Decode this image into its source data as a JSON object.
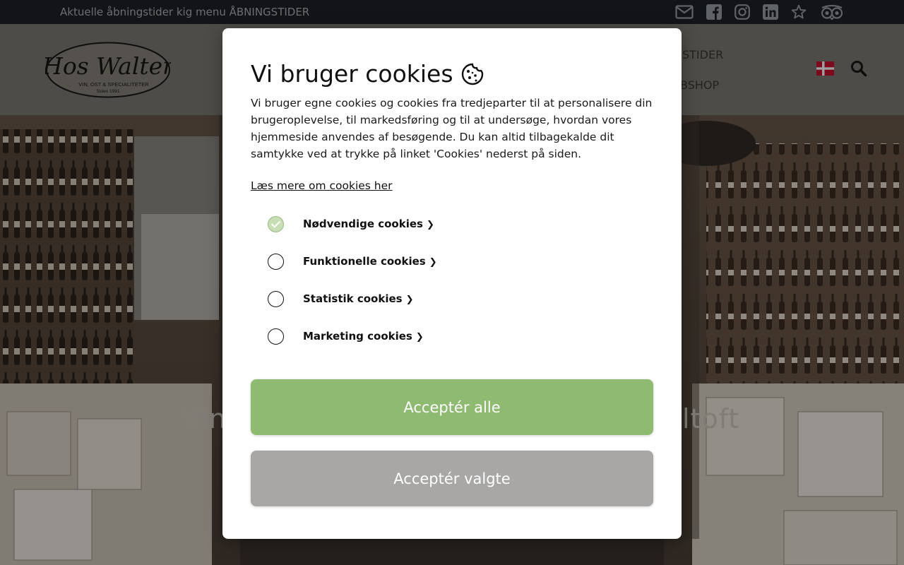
{
  "topbar": {
    "text": "Aktuelle åbningstider kig menu ÅBNINGSTIDER",
    "icons": [
      "envelope-icon",
      "facebook-icon",
      "instagram-icon",
      "linkedin-icon",
      "star-icon",
      "tripadvisor-icon"
    ]
  },
  "header": {
    "logo_title": "Hos Walter",
    "logo_subtitle": "VIN, OST & SPECIALITETER",
    "logo_since": "Siden 1991",
    "nav_partial_1": "STIDER",
    "nav_partial_2": "BSHOP",
    "flag": "denmark-flag",
    "icons": [
      "search-icon"
    ]
  },
  "hero": {
    "title_left": "Vin",
    "title_right": "ltoft"
  },
  "cookie_modal": {
    "title": "Vi bruger cookies",
    "description": "Vi bruger egne cookies og cookies fra tredjeparter til at personalisere din brugeroplevelse, til markedsføring og til at undersøge, hvordan vores hjemmeside anvendes af besøgende. Du kan altid tilbagekalde dit samtykke ved at trykke på linket 'Cookies' nederst på siden.",
    "read_more": "Læs mere om cookies her",
    "options": [
      {
        "label": "Nødvendige cookies",
        "checked": true
      },
      {
        "label": "Funktionelle cookies",
        "checked": false
      },
      {
        "label": "Statistik cookies",
        "checked": false
      },
      {
        "label": "Marketing cookies",
        "checked": false
      }
    ],
    "accept_all": "Acceptér alle",
    "accept_selected": "Acceptér valgte"
  },
  "colors": {
    "topbar": "#1e2126",
    "header": "#7f7b75",
    "accept_all": "#8fba72",
    "accept_selected": "#a8a7a6",
    "checked": "#c8dfb6"
  }
}
